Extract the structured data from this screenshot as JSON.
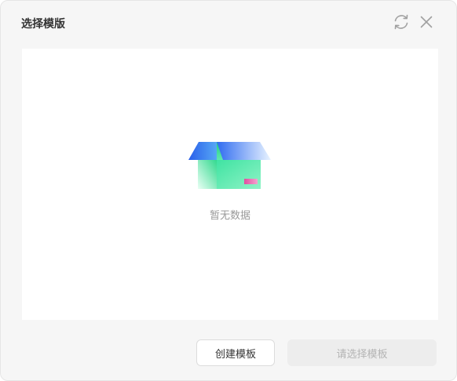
{
  "dialog": {
    "title": "选择模版",
    "icons": {
      "refresh": "refresh-icon",
      "close": "close-icon"
    }
  },
  "empty_state": {
    "icon": "empty-box-icon",
    "text": "暂无数据"
  },
  "footer": {
    "create_label": "创建模板",
    "select_label": "请选择模板",
    "select_enabled": false
  },
  "colors": {
    "background": "#f6f6f6",
    "panel": "#ffffff",
    "box_green": "#3ee29c",
    "box_blue": "#2f6bf0",
    "box_pink": "#e04fa0",
    "disabled_bg": "#ededed",
    "disabled_text": "#b4b4b4"
  }
}
